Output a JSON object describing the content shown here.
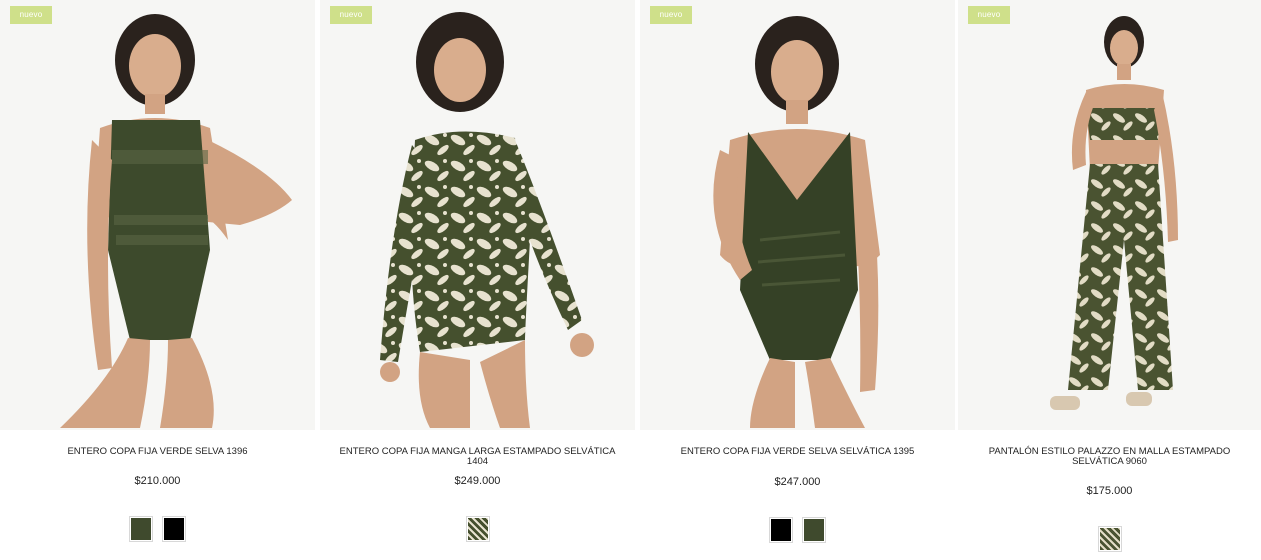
{
  "colors": {
    "badge": "#cfe08a",
    "olive": "#3f4a2d",
    "black": "#000000",
    "cream": "#e7e2cf"
  },
  "products": [
    {
      "badge": "nuevo",
      "name": "ENTERO COPA FIJA VERDE SELVA 1396",
      "price": "$210.000",
      "swatches": [
        "olive",
        "black"
      ]
    },
    {
      "badge": "nuevo",
      "name": "ENTERO COPA FIJA MANGA LARGA ESTAMPADO SELVÁTICA 1404",
      "price": "$249.000",
      "swatches": [
        "print"
      ]
    },
    {
      "badge": "nuevo",
      "name": "ENTERO COPA FIJA VERDE SELVA SELVÁTICA 1395",
      "price": "$247.000",
      "swatches": [
        "black",
        "olive"
      ]
    },
    {
      "badge": "nuevo",
      "name": "PANTALÓN ESTILO PALAZZO EN MALLA ESTAMPADO SELVÁTICA 9060",
      "price": "$175.000",
      "swatches": [
        "print"
      ]
    }
  ]
}
